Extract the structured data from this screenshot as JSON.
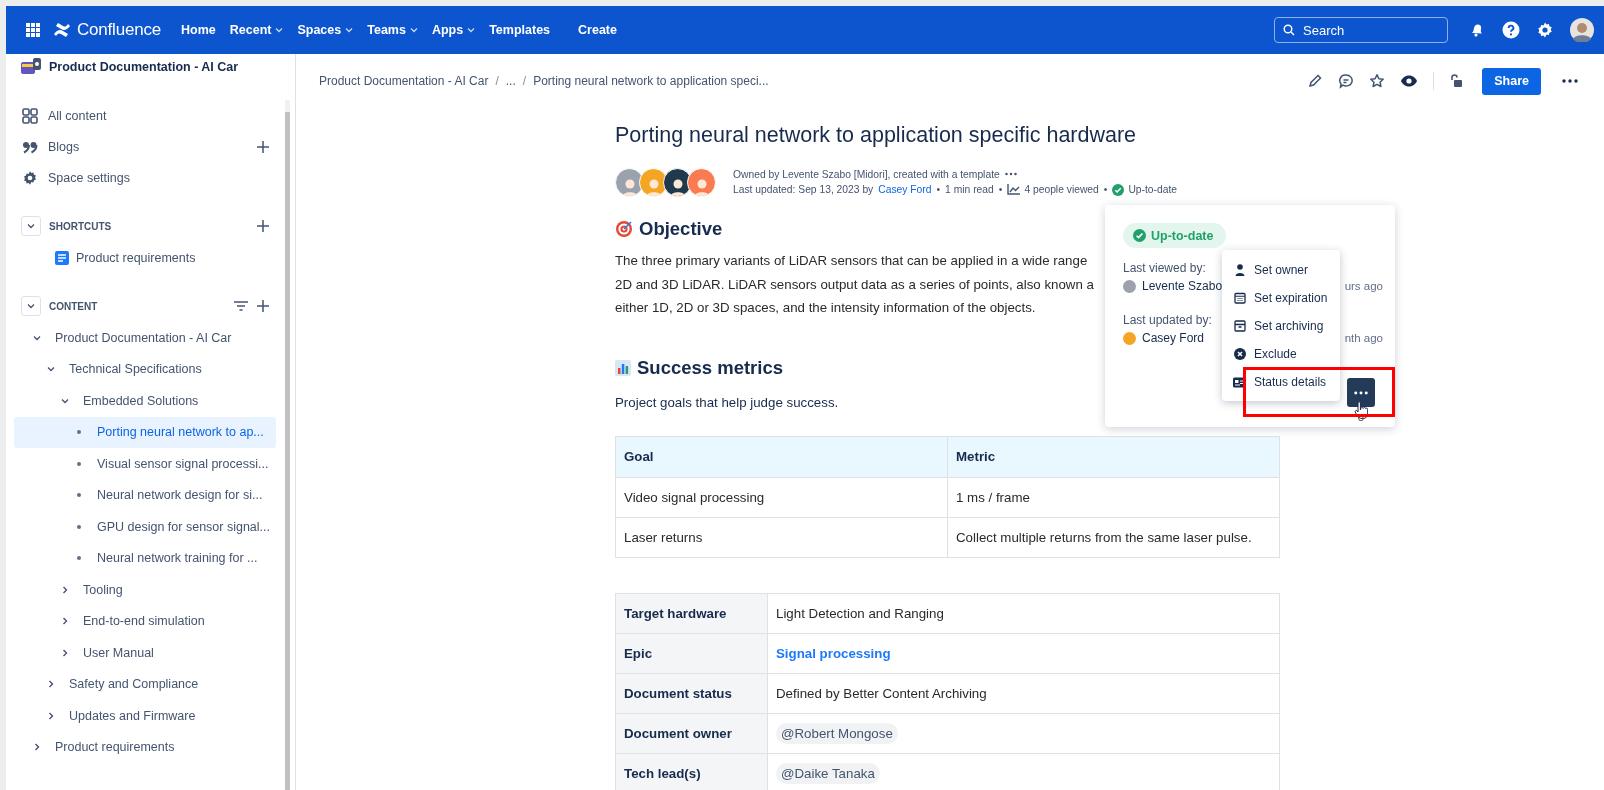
{
  "top_bar": {
    "product": "Confluence",
    "nav": [
      {
        "label": "Home",
        "dropdown": false
      },
      {
        "label": "Recent",
        "dropdown": true
      },
      {
        "label": "Spaces",
        "dropdown": true
      },
      {
        "label": "Teams",
        "dropdown": true
      },
      {
        "label": "Apps",
        "dropdown": true
      },
      {
        "label": "Templates",
        "dropdown": false
      }
    ],
    "create": "Create",
    "search": {
      "placeholder": "Search"
    }
  },
  "sidebar": {
    "space_name": "Product Documentation - AI Car",
    "links": [
      {
        "kind": "all",
        "label": "All content",
        "add": false
      },
      {
        "kind": "blogs",
        "label": "Blogs",
        "add": true
      },
      {
        "kind": "settings",
        "label": "Space settings",
        "add": false
      }
    ],
    "shortcuts": {
      "title": "SHORTCUTS",
      "expanded": true,
      "items": [
        {
          "label": "Product requirements"
        }
      ]
    },
    "content": {
      "title": "CONTENT",
      "expanded": true,
      "tree": [
        {
          "label": "Product Documentation - AI Car",
          "kind": "folder",
          "expanded": true,
          "selected": false,
          "children": [
            {
              "label": "Technical Specifications",
              "kind": "folder",
              "expanded": true,
              "selected": false,
              "children": [
                {
                  "label": "Embedded Solutions",
                  "kind": "folder",
                  "expanded": true,
                  "selected": false,
                  "children": [
                    {
                      "label": "Porting neural network to ap...",
                      "kind": "page",
                      "selected": true
                    },
                    {
                      "label": "Visual sensor signal processi...",
                      "kind": "page",
                      "selected": false
                    },
                    {
                      "label": "Neural network design for si...",
                      "kind": "page",
                      "selected": false
                    },
                    {
                      "label": "GPU design for sensor signal...",
                      "kind": "page",
                      "selected": false
                    },
                    {
                      "label": "Neural network training for ...",
                      "kind": "page",
                      "selected": false
                    }
                  ]
                },
                {
                  "label": "Tooling",
                  "kind": "folder",
                  "expanded": false,
                  "selected": false
                },
                {
                  "label": "End-to-end simulation",
                  "kind": "folder",
                  "expanded": false,
                  "selected": false
                },
                {
                  "label": "User Manual",
                  "kind": "folder",
                  "expanded": false,
                  "selected": false
                }
              ]
            },
            {
              "label": "Safety and Compliance",
              "kind": "folder",
              "expanded": false,
              "selected": false
            },
            {
              "label": "Updates and Firmware",
              "kind": "folder",
              "expanded": false,
              "selected": false
            }
          ]
        },
        {
          "label": "Product requirements",
          "kind": "folder",
          "expanded": false,
          "selected": false
        }
      ]
    }
  },
  "page": {
    "breadcrumb": [
      {
        "kind": "crumb",
        "text": "Product Documentation - AI Car"
      },
      {
        "kind": "sep",
        "text": "/"
      },
      {
        "kind": "crumb",
        "text": "..."
      },
      {
        "kind": "sep",
        "text": "/"
      },
      {
        "kind": "crumb",
        "text": "Porting neural network to application speci..."
      }
    ],
    "share": "Share",
    "title": "Porting neural network to application specific hardware",
    "byline": {
      "avatars": [
        {
          "color": "#9aa3ad"
        },
        {
          "color": "#f5a524"
        },
        {
          "color": "#1f3a4d"
        },
        {
          "color": "#f97b4f"
        }
      ],
      "owner_line": "Owned by Levente Szabo [Midori], created with a template",
      "updated_parts": [
        {
          "kind": "text",
          "text": "Last updated: Sep 13, 2023 by"
        },
        {
          "kind": "link",
          "text": "Casey Ford"
        },
        {
          "kind": "sep",
          "text": "•"
        },
        {
          "kind": "text",
          "text": "1 min read"
        },
        {
          "kind": "sep",
          "text": "•"
        },
        {
          "kind": "views",
          "text": "4 people viewed"
        },
        {
          "kind": "sep",
          "text": "•"
        },
        {
          "kind": "status",
          "text": "Up-to-date"
        }
      ]
    },
    "objective": {
      "heading": "Objective",
      "lines": [
        "The three primary variants of LiDAR sensors that can be applied in a wide range",
        "2D and 3D LiDAR. LiDAR sensors output data as a series of points, also known a",
        "either 1D, 2D or 3D spaces, and the intensity information of the objects."
      ]
    },
    "metrics": {
      "heading": "Success metrics",
      "intro": "Project goals that help judge success.",
      "table": {
        "columns": [
          "Goal",
          "Metric"
        ],
        "rows": [
          [
            "Video signal processing",
            "1 ms / frame"
          ],
          [
            "Laser returns",
            "Collect multiple returns from the same laser pulse."
          ]
        ]
      }
    },
    "details": {
      "rows": [
        {
          "label": "Target hardware",
          "value": "Light Detection and Ranging",
          "kind": "text"
        },
        {
          "label": "Epic",
          "value": "Signal processing",
          "kind": "link"
        },
        {
          "label": "Document status",
          "value": "Defined by Better Content Archiving",
          "kind": "text"
        },
        {
          "label": "Document owner",
          "value": "@Robert Mongose",
          "kind": "mention"
        },
        {
          "label": "Tech lead(s)",
          "value": "@Daike Tanaka",
          "kind": "mention"
        }
      ]
    }
  },
  "status_popover": {
    "status": "Up-to-date",
    "people": [
      {
        "label": "Last viewed by:",
        "name": "Levente Szabo",
        "time": "urs ago",
        "color": "#9aa3ad"
      },
      {
        "label": "Last updated by:",
        "name": "Casey Ford",
        "time": "nth ago",
        "color": "#f5a524"
      }
    ],
    "menu": [
      {
        "kind": "owner",
        "label": "Set owner"
      },
      {
        "kind": "expiration",
        "label": "Set expiration"
      },
      {
        "kind": "archiving",
        "label": "Set archiving"
      },
      {
        "kind": "exclude",
        "label": "Exclude"
      },
      {
        "kind": "details",
        "label": "Status details"
      }
    ],
    "callout": {
      "kind": "frame"
    }
  }
}
